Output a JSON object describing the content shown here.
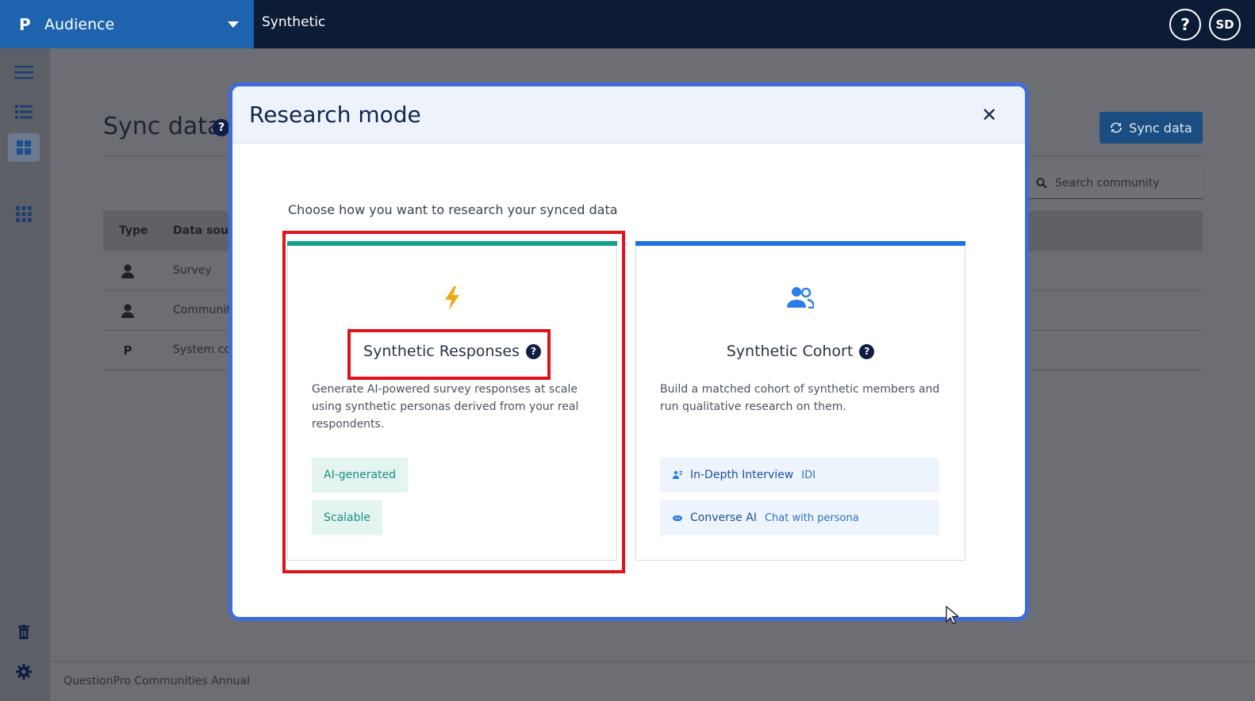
{
  "topbar": {
    "brand_logo": "P",
    "brand_name": "Audience",
    "title": "Synthetic",
    "help_label": "?",
    "avatar_initials": "SD"
  },
  "page": {
    "title": "Sync data",
    "title_help": "?",
    "sync_button_label": "Sync data",
    "search_placeholder": "Search community",
    "table": {
      "columns": [
        "Type",
        "Data source"
      ],
      "rows": [
        {
          "icon": "person-icon",
          "source": "Survey"
        },
        {
          "icon": "person-icon",
          "source": "Communit"
        },
        {
          "icon": "brand-p-icon",
          "source": "System co"
        }
      ]
    },
    "footer_text": "QuestionPro Communities Annual"
  },
  "modal": {
    "title": "Research mode",
    "close_label": "✕",
    "subtitle": "Choose how you want to research your synced data",
    "cards": [
      {
        "title": "Synthetic Responses",
        "help": "?",
        "description": "Generate AI-powered survey responses at scale using synthetic personas derived from your real respondents.",
        "accent": "#16a08e",
        "icon": "lightning-icon",
        "chips": [
          "AI-generated",
          "Scalable"
        ]
      },
      {
        "title": "Synthetic Cohort",
        "help": "?",
        "description": "Build a matched cohort of synthetic members and run qualitative research on them.",
        "accent": "#1f6fe5",
        "icon": "users-icon",
        "options": [
          {
            "label": "In-Depth Interview",
            "tag": "IDI",
            "icon": "interview-icon"
          },
          {
            "label": "Converse AI",
            "tag": "Chat with persona",
            "icon": "robot-icon"
          }
        ]
      }
    ]
  },
  "colors": {
    "highlight": "#e0121b",
    "modal_border": "#3d6cdc",
    "brand_blue": "#1d63ad",
    "topbar": "#0c1b36"
  }
}
